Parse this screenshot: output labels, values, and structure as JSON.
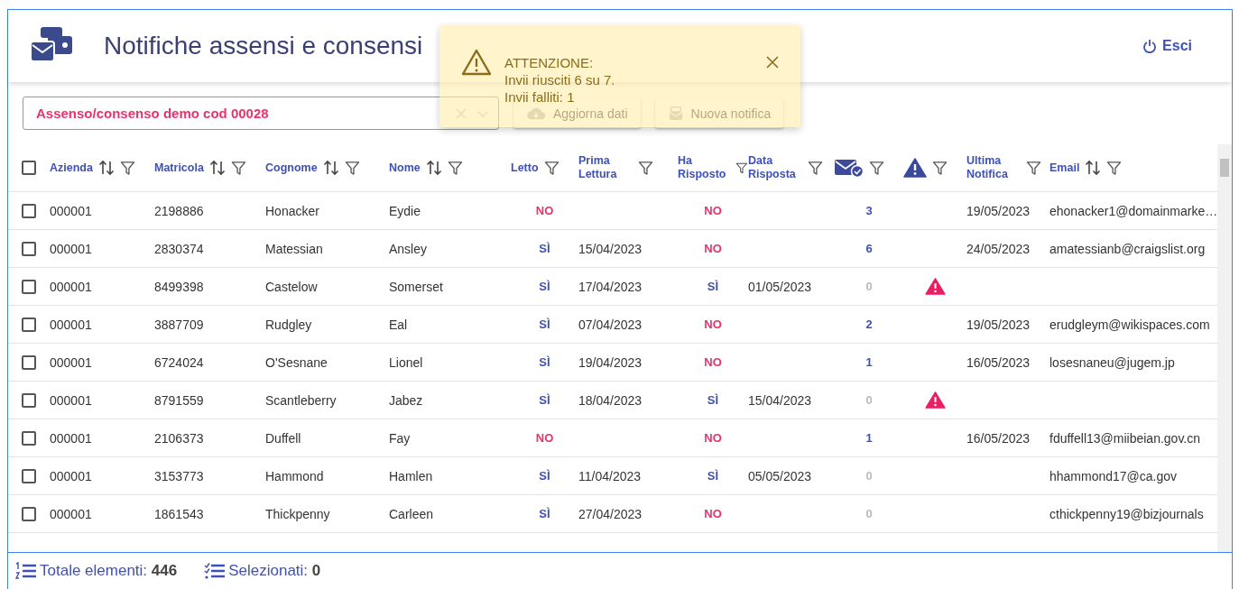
{
  "header": {
    "title": "Notifiche assensi e consensi",
    "logout": "Esci"
  },
  "selector": {
    "value": "Assenso/consenso demo cod 00028"
  },
  "toolbar": {
    "buttons": [
      "Aggiorna dati",
      "Nuova notifica"
    ]
  },
  "toast": {
    "title": "ATTENZIONE:",
    "lines": [
      "Invii riusciti 6 su 7.",
      "Invii falliti: 1"
    ]
  },
  "table": {
    "header_checked": false,
    "columns": [
      {
        "kind": "sortable",
        "label": "Azienda"
      },
      {
        "kind": "sortable",
        "label": "Matricola"
      },
      {
        "kind": "sortable",
        "label": "Cognome"
      },
      {
        "kind": "sortable",
        "label": "Nome"
      },
      {
        "kind": "text",
        "label": "Letto"
      },
      {
        "kind": "text",
        "label": "Prima Lettura"
      },
      {
        "kind": "text",
        "label": "Ha Risposto"
      },
      {
        "kind": "text",
        "label": "Data Risposta"
      },
      {
        "kind": "envelope"
      },
      {
        "kind": "warning"
      },
      {
        "kind": "text",
        "label": "Ultima Notifica"
      },
      {
        "kind": "sortable",
        "label": "Email"
      }
    ],
    "rows": [
      {
        "checked": false,
        "azienda": "000001",
        "matricola": "2198886",
        "cognome": "Honacker",
        "nome": "Eydie",
        "letto": {
          "text": "NO",
          "positive": false
        },
        "prima_lettura": "",
        "ha_risposto": {
          "text": "NO",
          "positive": false
        },
        "data_risposta": "",
        "notifiche": {
          "text": "3",
          "active": true
        },
        "alert": false,
        "ultima_notifica": "19/05/2023",
        "email": "ehonacker1@domainmarke…"
      },
      {
        "checked": false,
        "azienda": "000001",
        "matricola": "2830374",
        "cognome": "Matessian",
        "nome": "Ansley",
        "letto": {
          "text": "SÌ",
          "positive": true
        },
        "prima_lettura": "15/04/2023",
        "ha_risposto": {
          "text": "NO",
          "positive": false
        },
        "data_risposta": "",
        "notifiche": {
          "text": "6",
          "active": true
        },
        "alert": false,
        "ultima_notifica": "24/05/2023",
        "email": "amatessianb@craigslist.org"
      },
      {
        "checked": false,
        "azienda": "000001",
        "matricola": "8499398",
        "cognome": "Castelow",
        "nome": "Somerset",
        "letto": {
          "text": "SÌ",
          "positive": true
        },
        "prima_lettura": "17/04/2023",
        "ha_risposto": {
          "text": "SÌ",
          "positive": true
        },
        "data_risposta": "01/05/2023",
        "notifiche": {
          "text": "0",
          "active": false
        },
        "alert": true,
        "ultima_notifica": "",
        "email": ""
      },
      {
        "checked": false,
        "azienda": "000001",
        "matricola": "3887709",
        "cognome": "Rudgley",
        "nome": "Eal",
        "letto": {
          "text": "SÌ",
          "positive": true
        },
        "prima_lettura": "07/04/2023",
        "ha_risposto": {
          "text": "NO",
          "positive": false
        },
        "data_risposta": "",
        "notifiche": {
          "text": "2",
          "active": true
        },
        "alert": false,
        "ultima_notifica": "19/05/2023",
        "email": "erudgleym@wikispaces.com"
      },
      {
        "checked": false,
        "azienda": "000001",
        "matricola": "6724024",
        "cognome": "O'Sesnane",
        "nome": "Lionel",
        "letto": {
          "text": "SÌ",
          "positive": true
        },
        "prima_lettura": "19/04/2023",
        "ha_risposto": {
          "text": "NO",
          "positive": false
        },
        "data_risposta": "",
        "notifiche": {
          "text": "1",
          "active": true
        },
        "alert": false,
        "ultima_notifica": "16/05/2023",
        "email": "losesnaneu@jugem.jp"
      },
      {
        "checked": false,
        "azienda": "000001",
        "matricola": "8791559",
        "cognome": "Scantleberry",
        "nome": "Jabez",
        "letto": {
          "text": "SÌ",
          "positive": true
        },
        "prima_lettura": "18/04/2023",
        "ha_risposto": {
          "text": "SÌ",
          "positive": true
        },
        "data_risposta": "15/04/2023",
        "notifiche": {
          "text": "0",
          "active": false
        },
        "alert": true,
        "ultima_notifica": "",
        "email": ""
      },
      {
        "checked": false,
        "azienda": "000001",
        "matricola": "2106373",
        "cognome": "Duffell",
        "nome": "Fay",
        "letto": {
          "text": "NO",
          "positive": false
        },
        "prima_lettura": "",
        "ha_risposto": {
          "text": "NO",
          "positive": false
        },
        "data_risposta": "",
        "notifiche": {
          "text": "1",
          "active": true
        },
        "alert": false,
        "ultima_notifica": "16/05/2023",
        "email": "fduffell13@miibeian.gov.cn"
      },
      {
        "checked": false,
        "azienda": "000001",
        "matricola": "3153773",
        "cognome": "Hammond",
        "nome": "Hamlen",
        "letto": {
          "text": "SÌ",
          "positive": true
        },
        "prima_lettura": "11/04/2023",
        "ha_risposto": {
          "text": "SÌ",
          "positive": true
        },
        "data_risposta": "05/05/2023",
        "notifiche": {
          "text": "0",
          "active": false
        },
        "alert": false,
        "ultima_notifica": "",
        "email": "hhammond17@ca.gov"
      },
      {
        "checked": false,
        "azienda": "000001",
        "matricola": "1861543",
        "cognome": "Thickpenny",
        "nome": "Carleen",
        "letto": {
          "text": "SÌ",
          "positive": true
        },
        "prima_lettura": "27/04/2023",
        "ha_risposto": {
          "text": "NO",
          "positive": false
        },
        "data_risposta": "",
        "notifiche": {
          "text": "0",
          "active": false
        },
        "alert": false,
        "ultima_notifica": "",
        "email": "cthickpenny19@bizjournals"
      }
    ]
  },
  "footer": {
    "total_label": "Totale elementi:",
    "total": "446",
    "selected_label": "Selezionati:",
    "selected": "0"
  }
}
